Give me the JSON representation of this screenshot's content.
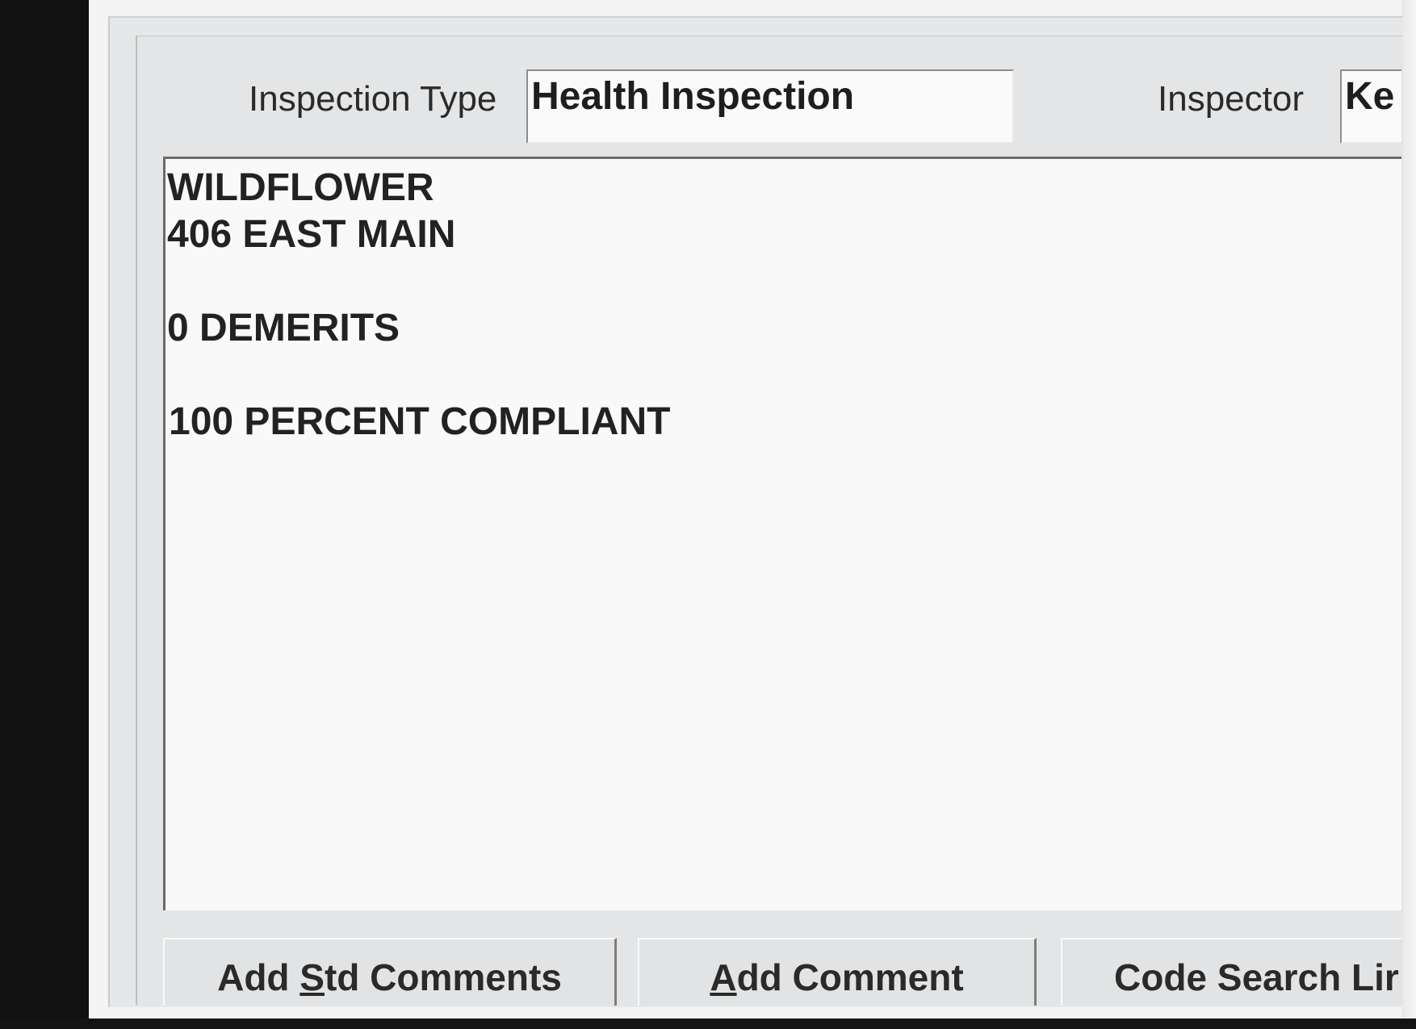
{
  "header": {
    "inspection_type_label": "Inspection Type",
    "inspection_type_value": "Health Inspection",
    "inspector_label": "Inspector",
    "inspector_value": "Ke"
  },
  "comments": {
    "lines": [
      "WILDFLOWER",
      "406 EAST MAIN",
      "",
      "0 DEMERITS",
      "",
      "100 PERCENT COMPLIANT"
    ]
  },
  "buttons": {
    "add_std_comments": {
      "pre": "Add ",
      "mnemonic": "S",
      "post": "td Comments"
    },
    "add_comment": {
      "pre": "",
      "mnemonic": "A",
      "post": "dd Comment"
    },
    "code_search": {
      "label": "Code Search Lir"
    }
  }
}
